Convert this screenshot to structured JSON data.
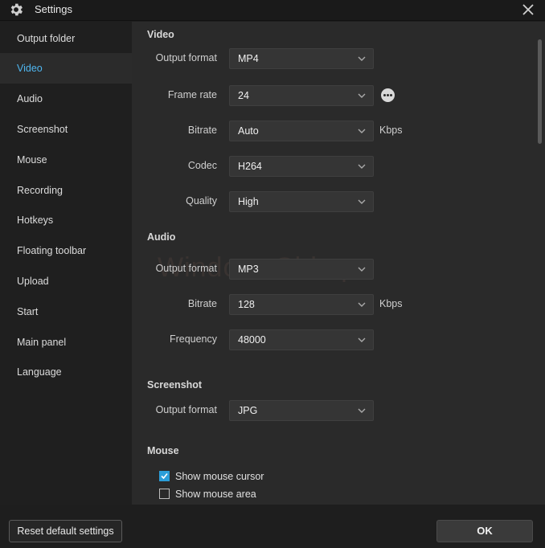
{
  "window": {
    "title": "Settings",
    "icon": "gear-icon",
    "close_icon": "close-icon"
  },
  "sidebar": {
    "items": [
      {
        "label": "Output folder",
        "active": false
      },
      {
        "label": "Video",
        "active": true
      },
      {
        "label": "Audio",
        "active": false
      },
      {
        "label": "Screenshot",
        "active": false
      },
      {
        "label": "Mouse",
        "active": false
      },
      {
        "label": "Recording",
        "active": false
      },
      {
        "label": "Hotkeys",
        "active": false
      },
      {
        "label": "Floating toolbar",
        "active": false
      },
      {
        "label": "Upload",
        "active": false
      },
      {
        "label": "Start",
        "active": false
      },
      {
        "label": "Main panel",
        "active": false
      },
      {
        "label": "Language",
        "active": false
      }
    ]
  },
  "video": {
    "title": "Video",
    "output_format": {
      "label": "Output format",
      "value": "MP4"
    },
    "frame_rate": {
      "label": "Frame rate",
      "value": "24"
    },
    "bitrate": {
      "label": "Bitrate",
      "value": "Auto",
      "unit": "Kbps"
    },
    "codec": {
      "label": "Codec",
      "value": "H264"
    },
    "quality": {
      "label": "Quality",
      "value": "High"
    }
  },
  "audio": {
    "title": "Audio",
    "output_format": {
      "label": "Output format",
      "value": "MP3"
    },
    "bitrate": {
      "label": "Bitrate",
      "value": "128",
      "unit": "Kbps"
    },
    "frequency": {
      "label": "Frequency",
      "value": "48000"
    }
  },
  "screenshot": {
    "title": "Screenshot",
    "output_format": {
      "label": "Output format",
      "value": "JPG"
    }
  },
  "mouse": {
    "title": "Mouse",
    "show_cursor": {
      "label": "Show mouse cursor",
      "checked": true
    },
    "show_area": {
      "label": "Show mouse area",
      "checked": false
    }
  },
  "watermark": "WindowsChimp",
  "footer": {
    "reset_label": "Reset default settings",
    "ok_label": "OK"
  },
  "colors": {
    "accent": "#4fb6f0",
    "checkbox": "#2b9ed9",
    "panel": "#2a2a2a",
    "sidebar": "#1f1f1f"
  }
}
